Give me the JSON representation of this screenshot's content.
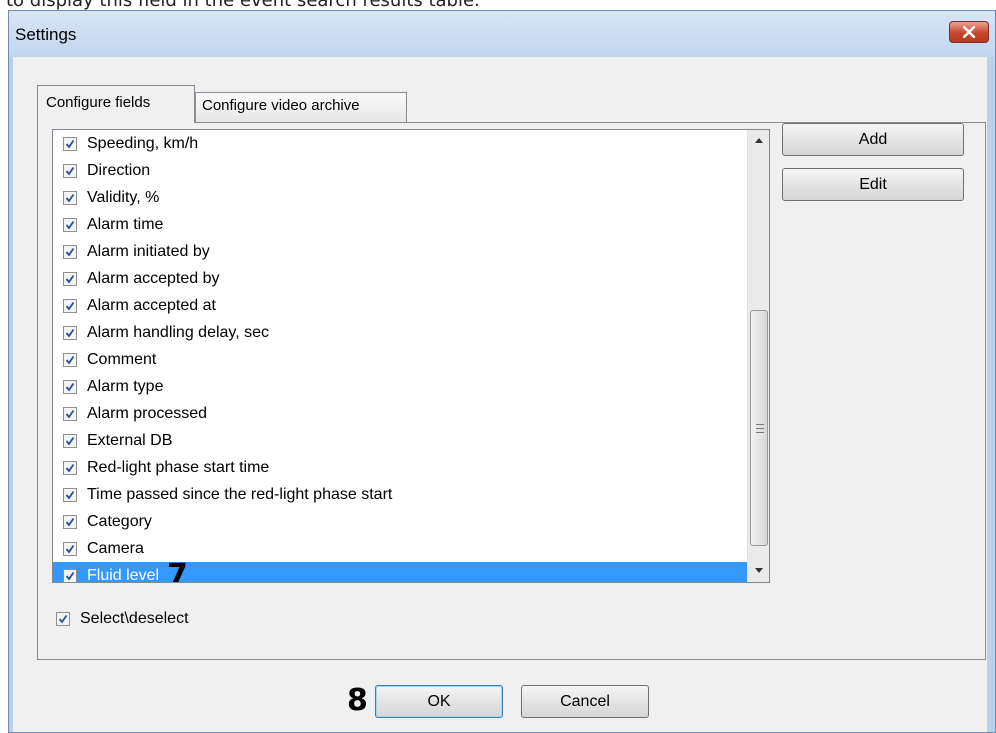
{
  "page_caption": "to display this field in the event search results table.",
  "window": {
    "title": "Settings"
  },
  "tabs": [
    {
      "label": "Configure fields",
      "active": true
    },
    {
      "label": "Configure video archive",
      "active": false
    }
  ],
  "fields_list": {
    "items": [
      {
        "label": "Speeding, km/h",
        "checked": true
      },
      {
        "label": "Direction",
        "checked": true
      },
      {
        "label": "Validity, %",
        "checked": true
      },
      {
        "label": "Alarm time",
        "checked": true
      },
      {
        "label": "Alarm initiated by",
        "checked": true
      },
      {
        "label": "Alarm accepted by",
        "checked": true
      },
      {
        "label": "Alarm accepted at",
        "checked": true
      },
      {
        "label": "Alarm handling delay, sec",
        "checked": true
      },
      {
        "label": "Comment",
        "checked": true
      },
      {
        "label": "Alarm type",
        "checked": true
      },
      {
        "label": "Alarm processed",
        "checked": true
      },
      {
        "label": "External DB",
        "checked": true
      },
      {
        "label": "Red-light phase start time",
        "checked": true
      },
      {
        "label": "Time passed since the red-light phase start",
        "checked": true
      },
      {
        "label": "Category",
        "checked": true
      },
      {
        "label": "Camera",
        "checked": true
      },
      {
        "label": "Fluid level",
        "checked": true,
        "selected": true
      }
    ]
  },
  "side_buttons": {
    "add": "Add",
    "edit": "Edit"
  },
  "select_all": {
    "label": "Select\\deselect",
    "checked": true
  },
  "footer": {
    "ok": "OK",
    "cancel": "Cancel"
  },
  "annotations": {
    "marker_list_item": "7",
    "marker_ok": "8"
  },
  "colors": {
    "selection": "#3399ff",
    "window_frame": "#b9d1ea",
    "close_button": "#c8472e"
  },
  "icons": [
    "close-icon",
    "checkmark-icon",
    "scroll-up-icon",
    "scroll-down-icon",
    "scroll-grip-icon"
  ]
}
